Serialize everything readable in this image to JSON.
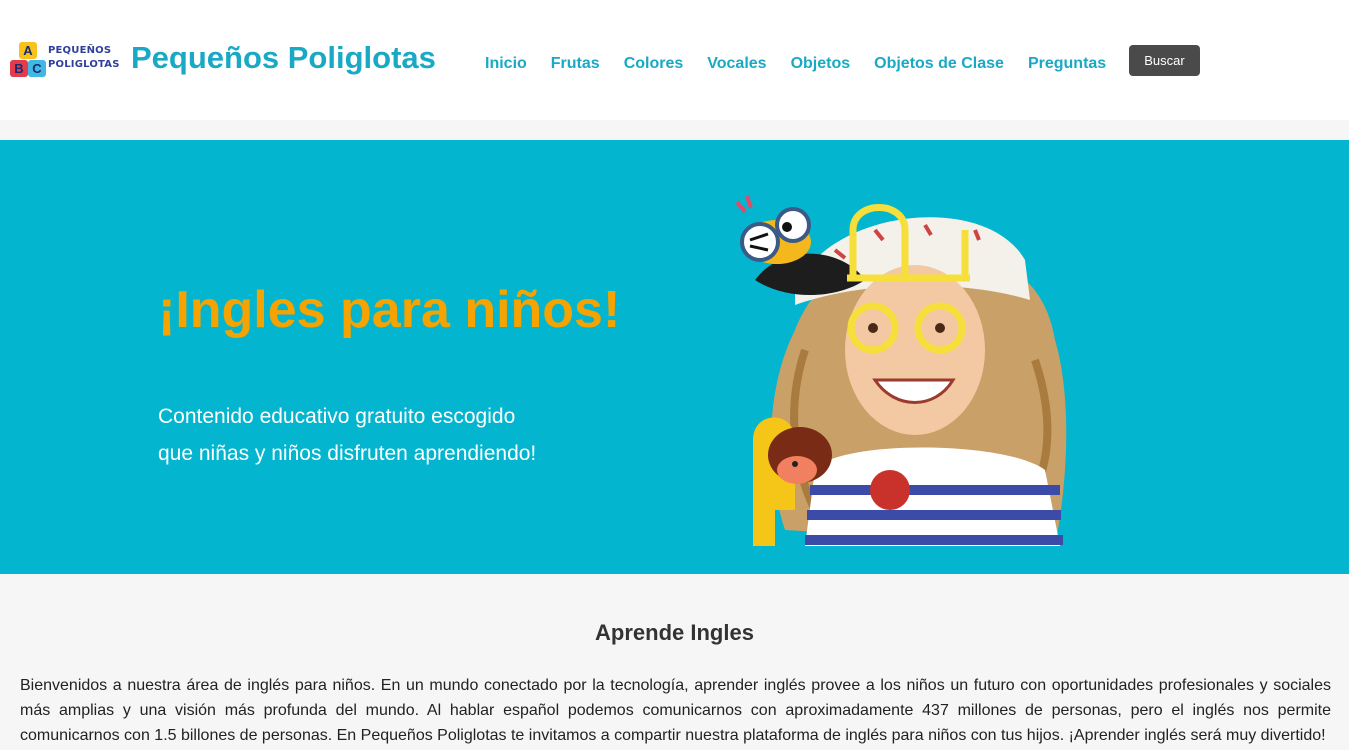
{
  "header": {
    "logo": {
      "blocks": [
        "A",
        "B",
        "C"
      ],
      "line1": "PEQUEÑOS",
      "line2": "POLIGLOTAS"
    },
    "site_title": "Pequeños Poliglotas",
    "nav": [
      "Inicio",
      "Frutas",
      "Colores",
      "Vocales",
      "Objetos",
      "Objetos de Clase",
      "Preguntas"
    ],
    "search_label": "Buscar"
  },
  "hero": {
    "title": "¡Ingles para niños!",
    "subtitle_line1": "Contenido educativo gratuito escogido",
    "subtitle_line2": "que niñas y niños disfruten aprendiendo!"
  },
  "section": {
    "title": "Aprende Ingles",
    "body": "Bienvenidos a nuestra área de inglés para niños. En un mundo conectado por la tecnología, aprender inglés provee a los niños un futuro con oportunidades profesionales y sociales más amplias y una visión más profunda del mundo. Al hablar español podemos comunicarnos con aproximadamente 437 millones de personas, pero el inglés nos permite comunicarnos con 1.5 billones de personas. En Pequeños Poliglotas te invitamos a compartir nuestra plataforma de inglés para niños con tus hijos. ¡Aprender inglés será muy divertido!"
  },
  "colors": {
    "brand": "#1aa9c4",
    "hero_bg": "#03b5cf",
    "hero_title": "#f5a300",
    "button_bg": "#4a4a4a"
  }
}
